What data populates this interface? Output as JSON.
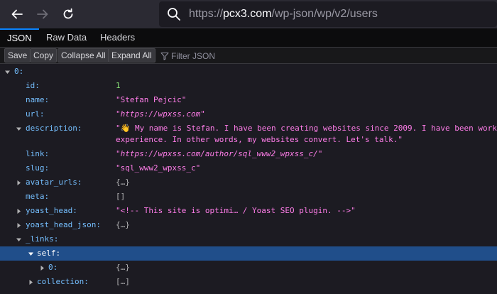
{
  "browser": {
    "url_scheme": "https://",
    "url_host": "pcx3.com",
    "url_path": "/wp-json/wp/v2/users"
  },
  "tabs": [
    "JSON",
    "Raw Data",
    "Headers"
  ],
  "toolbar": {
    "save": "Save",
    "copy": "Copy",
    "collapse_all": "Collapse All",
    "expand_all": "Expand All",
    "filter_placeholder": "Filter JSON"
  },
  "tree": {
    "root_key": "0:",
    "id_key": "id:",
    "id_val": "1",
    "name_key": "name:",
    "name_val": "\"Stefan Pejcic\"",
    "url_key": "url:",
    "url_val": "\"https://wpxss.com\"",
    "description_key": "description:",
    "description_val_1": "\"👋 My name is Stefan. I have been creating websites since 2009. I have been worki",
    "description_val_2": "experience. In other words, my websites convert. Let's talk.\"",
    "link_key": "link:",
    "link_val": "\"https://wpxss.com/author/sql_www2_wpxss_c/\"",
    "slug_key": "slug:",
    "slug_val": "\"sql_www2_wpxss_c\"",
    "avatar_key": "avatar_urls:",
    "avatar_val": "{…}",
    "meta_key": "meta:",
    "meta_val": "[]",
    "yoast_head_key": "yoast_head:",
    "yoast_head_val": "\"<!-- This site is optimi… / Yoast SEO plugin. -->\"",
    "yoast_json_key": "yoast_head_json:",
    "yoast_json_val": "{…}",
    "links_key": "_links:",
    "self_key": "self:",
    "self0_key": "0:",
    "self0_val": "{…}",
    "collection_key": "collection:",
    "collection_val": "[…]"
  },
  "colors": {
    "key": "#75bfff",
    "string": "#ff7de9",
    "number": "#86de74",
    "selected_row": "#204e8a"
  }
}
